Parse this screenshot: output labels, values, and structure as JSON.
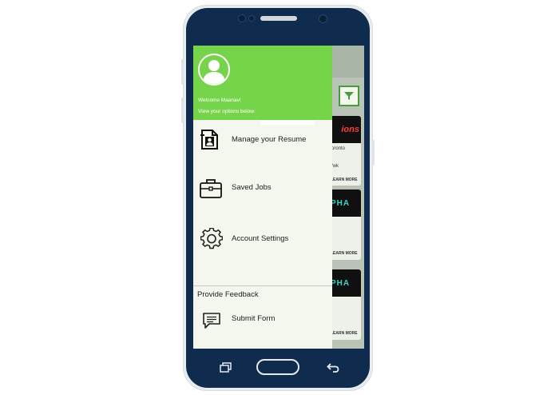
{
  "drawer": {
    "welcome": "Welcome Maanav!",
    "subtitle": "View your options below:",
    "items": [
      {
        "label": "Manage your Resume",
        "icon": "resume-icon"
      },
      {
        "label": "Saved Jobs",
        "icon": "briefcase-icon"
      },
      {
        "label": "Account Settings",
        "icon": "gear-icon"
      }
    ],
    "feedback_section": {
      "title": "Provide Feedback",
      "item": {
        "label": "Submit Form",
        "icon": "chat-icon"
      }
    }
  },
  "background": {
    "cards": [
      {
        "logo": "ions",
        "location": "oronto",
        "pay": "/wk",
        "action": "LEARN MORE"
      },
      {
        "logo": "PHA",
        "action": "LEARN MORE"
      },
      {
        "logo": "PHA",
        "action": "LEARN MORE"
      }
    ]
  },
  "colors": {
    "drawer_header": "#76d44a",
    "drawer_bg": "#f3f7ee",
    "phone_body": "#0f2c4f",
    "filter_accent": "#4a9a3f"
  }
}
